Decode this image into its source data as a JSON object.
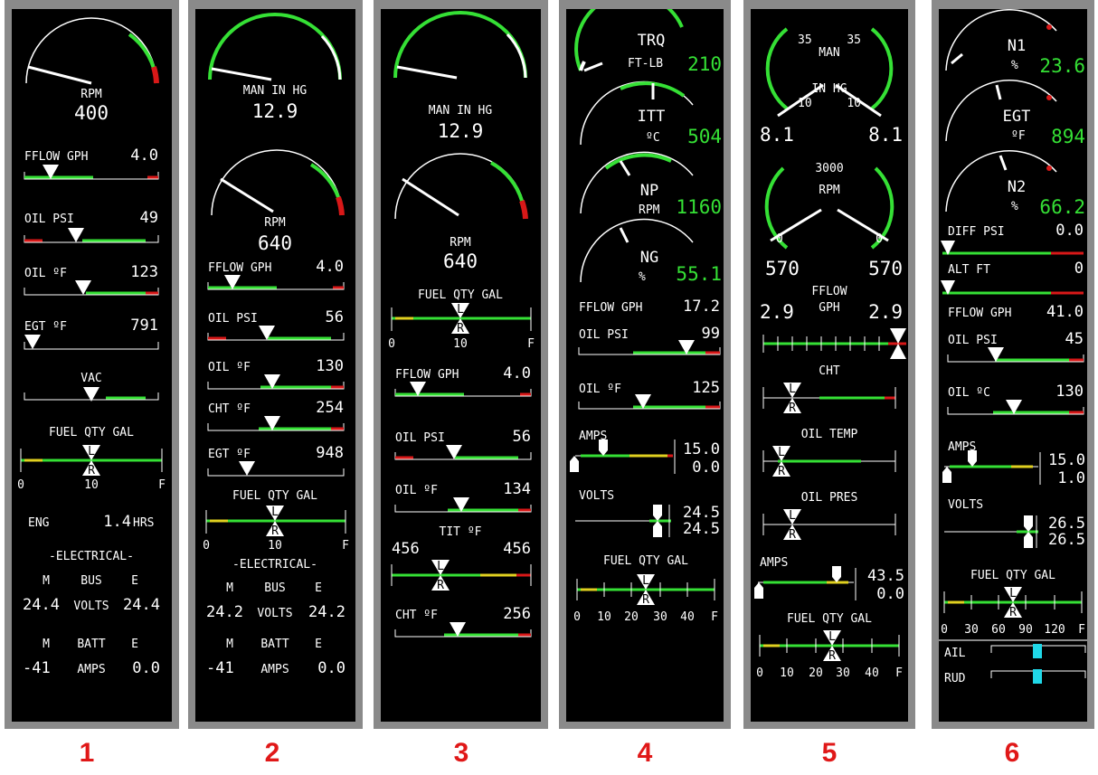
{
  "panels": [
    {
      "number": "1",
      "rpm": {
        "label": "RPM",
        "value": "400"
      },
      "fflow": {
        "label": "FFLOW GPH",
        "value": "4.0"
      },
      "oil_psi": {
        "label": "OIL PSI",
        "value": "49"
      },
      "oil_f": {
        "label": "OIL ºF",
        "value": "123"
      },
      "egt": {
        "label": "EGT ºF",
        "value": "791"
      },
      "vac": {
        "label": "VAC"
      },
      "fuel": {
        "label": "FUEL QTY GAL",
        "tick_left": "0",
        "tick_mid": "10",
        "tick_right": "F",
        "left_tank": "L",
        "right_tank": "R"
      },
      "eng": {
        "label": "ENG",
        "value": "1.4",
        "unit": "HRS"
      },
      "electrical": {
        "title": "-ELECTRICAL-",
        "bus_m": "M",
        "bus_label": "BUS",
        "bus_e": "E",
        "volts_m": "24.4",
        "volts_label": "VOLTS",
        "volts_e": "24.4",
        "batt_m": "M",
        "batt_label": "BATT",
        "batt_e": "E",
        "amps_m": "-41",
        "amps_label": "AMPS",
        "amps_e": "0.0"
      }
    },
    {
      "number": "2",
      "man": {
        "label": "MAN IN HG",
        "value": "12.9"
      },
      "rpm": {
        "label": "RPM",
        "value": "640"
      },
      "fflow": {
        "label": "FFLOW GPH",
        "value": "4.0"
      },
      "oil_psi": {
        "label": "OIL PSI",
        "value": "56"
      },
      "oil_f": {
        "label": "OIL ºF",
        "value": "130"
      },
      "cht": {
        "label": "CHT ºF",
        "value": "254"
      },
      "egt": {
        "label": "EGT ºF",
        "value": "948"
      },
      "fuel": {
        "label": "FUEL QTY GAL",
        "tick_left": "0",
        "tick_mid": "10",
        "tick_right": "F",
        "left_tank": "L",
        "right_tank": "R"
      },
      "electrical": {
        "title": "-ELECTRICAL-",
        "bus_m": "M",
        "bus_label": "BUS",
        "bus_e": "E",
        "volts_m": "24.2",
        "volts_label": "VOLTS",
        "volts_e": "24.2",
        "batt_m": "M",
        "batt_label": "BATT",
        "batt_e": "E",
        "amps_m": "-41",
        "amps_label": "AMPS",
        "amps_e": "0.0"
      }
    },
    {
      "number": "3",
      "man": {
        "label": "MAN IN HG",
        "value": "12.9"
      },
      "rpm": {
        "label": "RPM",
        "value": "640"
      },
      "fuel": {
        "label": "FUEL QTY GAL",
        "tick_left": "0",
        "tick_mid": "10",
        "tick_right": "F",
        "left_tank": "L",
        "right_tank": "R"
      },
      "fflow": {
        "label": "FFLOW GPH",
        "value": "4.0"
      },
      "oil_psi": {
        "label": "OIL PSI",
        "value": "56"
      },
      "oil_f": {
        "label": "OIL ºF",
        "value": "134"
      },
      "tit": {
        "label": "TIT ºF",
        "left": "456",
        "right": "456",
        "left_tank": "L",
        "right_tank": "R"
      },
      "cht": {
        "label": "CHT ºF",
        "value": "256"
      }
    },
    {
      "number": "4",
      "trq": {
        "label": "TRQ",
        "unit": "FT-LB",
        "value": "210"
      },
      "itt": {
        "label": "ITT",
        "unit": "ºC",
        "value": "504"
      },
      "np": {
        "label": "NP",
        "unit": "RPM",
        "value": "1160"
      },
      "ng": {
        "label": "NG",
        "unit": "%",
        "value": "55.1"
      },
      "fflow": {
        "label": "FFLOW GPH",
        "value": "17.2"
      },
      "oil_psi": {
        "label": "OIL PSI",
        "value": "99"
      },
      "oil_f": {
        "label": "OIL ºF",
        "value": "125"
      },
      "amps": {
        "label": "AMPS",
        "top": "15.0",
        "bottom": "0.0"
      },
      "volts": {
        "label": "VOLTS",
        "top": "24.5",
        "bottom": "24.5"
      },
      "fuel": {
        "label": "FUEL QTY GAL",
        "ticks": [
          "0",
          "10",
          "20",
          "30",
          "40",
          "F"
        ],
        "left_tank": "L",
        "right_tank": "R"
      }
    },
    {
      "number": "5",
      "man": {
        "label_top": "MAN",
        "label_bottom": "IN HG",
        "tick_left": "35",
        "tick_right": "35",
        "tick_low_left": "10",
        "tick_low_right": "10",
        "left": "8.1",
        "right": "8.1"
      },
      "rpm": {
        "tick_top": "3000",
        "label": "RPM",
        "tick_low_left": "0",
        "tick_low_right": "0",
        "left": "570",
        "right": "570"
      },
      "fflow": {
        "label": "FFLOW",
        "unit": "GPH",
        "left": "2.9",
        "right": "2.9"
      },
      "cht": {
        "label": "CHT",
        "left_tank": "L",
        "right_tank": "R"
      },
      "oil_temp": {
        "label": "OIL TEMP",
        "left_tank": "L",
        "right_tank": "R"
      },
      "oil_pres": {
        "label": "OIL PRES",
        "left_tank": "L",
        "right_tank": "R"
      },
      "amps": {
        "label": "AMPS",
        "top": "43.5",
        "bottom": "0.0"
      },
      "fuel": {
        "label": "FUEL QTY GAL",
        "ticks": [
          "0",
          "10",
          "20",
          "30",
          "40",
          "F"
        ],
        "left_tank": "L",
        "right_tank": "R"
      }
    },
    {
      "number": "6",
      "n1": {
        "label": "N1",
        "unit": "%",
        "value": "23.6"
      },
      "egt": {
        "label": "EGT",
        "unit": "ºF",
        "value": "894"
      },
      "n2": {
        "label": "N2",
        "unit": "%",
        "value": "66.2"
      },
      "diff_psi": {
        "label": "DIFF PSI",
        "value": "0.0"
      },
      "alt": {
        "label": "ALT FT",
        "value": "0"
      },
      "fflow": {
        "label": "FFLOW GPH",
        "value": "41.0"
      },
      "oil_psi": {
        "label": "OIL PSI",
        "value": "45"
      },
      "oil_c": {
        "label": "OIL ºC",
        "value": "130"
      },
      "amps": {
        "label": "AMPS",
        "top": "15.0",
        "bottom": "1.0"
      },
      "volts": {
        "label": "VOLTS",
        "top": "26.5",
        "bottom": "26.5"
      },
      "fuel": {
        "label": "FUEL QTY GAL",
        "ticks": [
          "0",
          "30",
          "60",
          "90",
          "120",
          "F"
        ],
        "left_tank": "L",
        "right_tank": "R"
      },
      "trim": {
        "ail": "AIL",
        "rud": "RUD"
      }
    }
  ],
  "colors": {
    "green": "#35e035",
    "red": "#d81818",
    "yellow": "#e0d020",
    "white": "#ffffff",
    "bezel": "#8a8a8a",
    "label": "#e01818"
  }
}
